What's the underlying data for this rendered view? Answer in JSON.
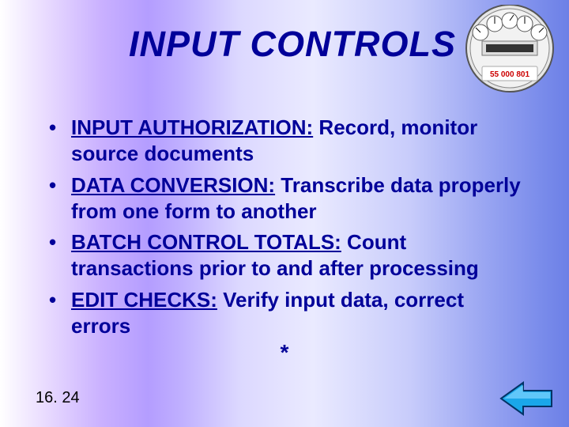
{
  "title": "INPUT CONTROLS",
  "bullets": [
    {
      "term": "INPUT AUTHORIZATION:",
      "desc": " Record, monitor source documents"
    },
    {
      "term": "DATA CONVERSION:",
      "desc": " Transcribe data properly from one form to another"
    },
    {
      "term": "BATCH CONTROL TOTALS:",
      "desc": " Count transactions prior to and after processing"
    },
    {
      "term": "EDIT CHECKS:",
      "desc": " Verify input data, correct errors"
    }
  ],
  "asterisk": "*",
  "slide_number": "16. 24",
  "meter_reading": "55 000 801",
  "colors": {
    "text": "#000099",
    "arrow_fill": "#00a0e9",
    "arrow_stroke": "#003366"
  }
}
